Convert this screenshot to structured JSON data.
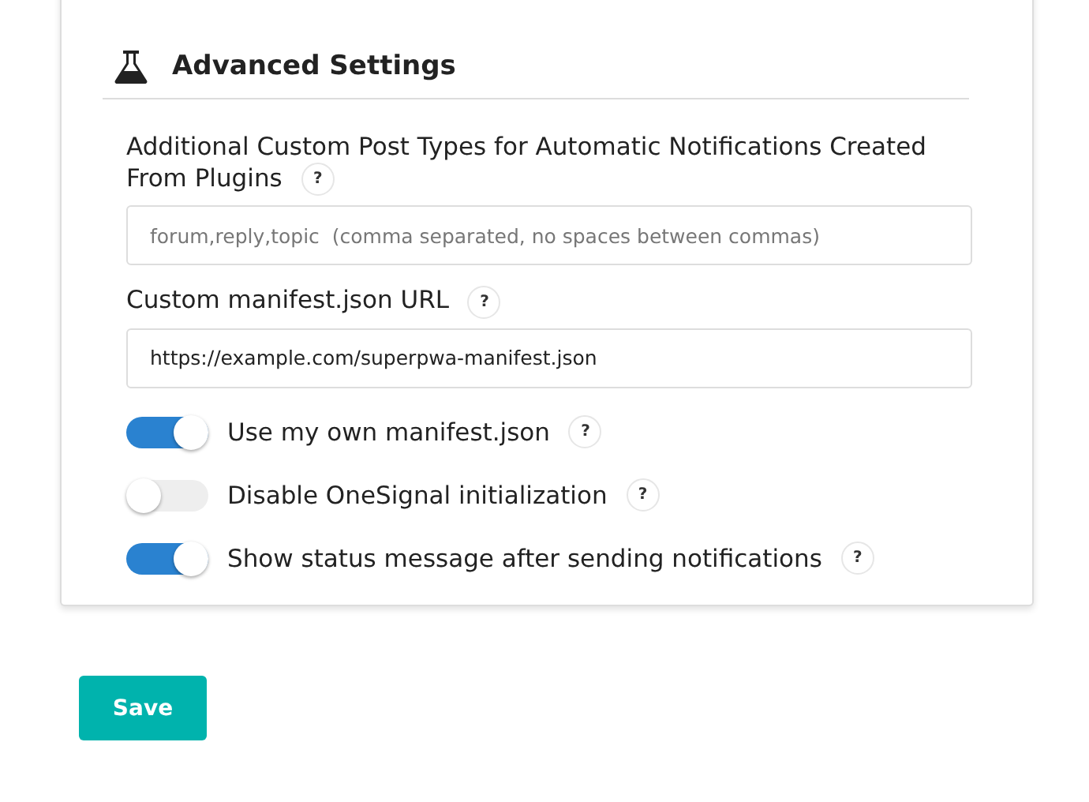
{
  "section": {
    "title": "Advanced Settings"
  },
  "fields": [
    {
      "label": "Additional Custom Post Types for Automatic Notifications Created From Plugins",
      "help": "?",
      "placeholder": "forum,reply,topic  (comma separated, no spaces between commas)"
    },
    {
      "label": "Custom manifest.json URL",
      "help": "?",
      "value": "https://example.com/superpwa-manifest.json"
    }
  ],
  "toggles": [
    {
      "label": "Use my own manifest.json",
      "help": "?",
      "on": true
    },
    {
      "label": "Disable OneSignal initialization",
      "help": "?",
      "on": false
    },
    {
      "label": "Show status message after sending notifications",
      "help": "?",
      "on": true
    }
  ],
  "save_button": "Save"
}
